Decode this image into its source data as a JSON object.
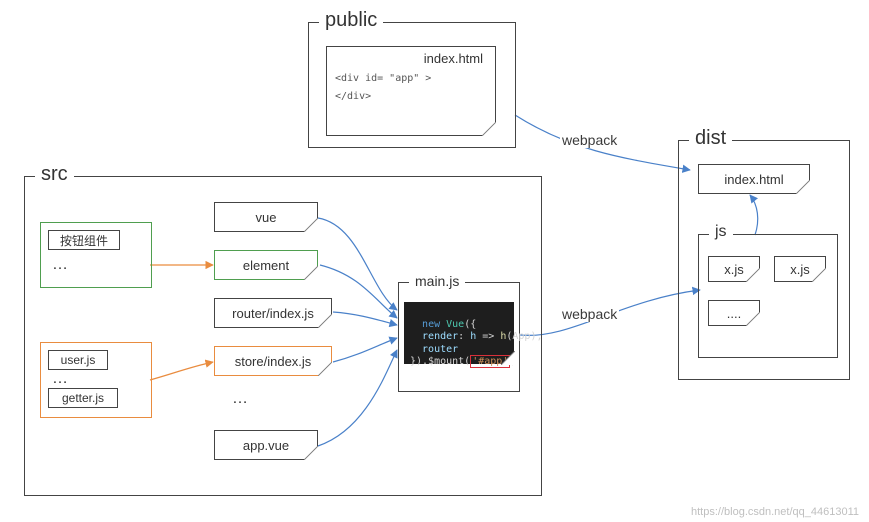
{
  "sections": {
    "public": {
      "title": "public"
    },
    "src": {
      "title": "src"
    },
    "dist": {
      "title": "dist"
    },
    "js": {
      "title": "js"
    }
  },
  "public_file": {
    "name": "index.html",
    "code_line1": "<div id= \"app\" >",
    "code_line2": "</div>"
  },
  "dist": {
    "index": "index.html",
    "js_items": [
      "x.js",
      "x.js",
      "...."
    ]
  },
  "src": {
    "button_components_label": "按钮组件",
    "user_js": "user.js",
    "getter_js": "getter.js",
    "modules": {
      "vue": "vue",
      "element": "element",
      "router": "router/index.js",
      "store": "store/index.js",
      "app": "app.vue"
    },
    "mainjs_title": "main.js",
    "mainjs_code": {
      "l1_new": "new",
      "l1_vue": " Vue",
      "l1_rest": "({",
      "l2_render": "  render",
      "l2_mid": ": ",
      "l2_h": "h",
      "l2_arrow": " => ",
      "l2_hfn": "h",
      "l2_app": "(App),",
      "l3": "  router",
      "l4_pre": "}).$mount(",
      "l4_arg": "'#app'",
      "l4_post": ")"
    }
  },
  "arrows": {
    "webpack1": "webpack",
    "webpack2": "webpack"
  },
  "watermark": "https://blog.csdn.net/qq_44613011"
}
